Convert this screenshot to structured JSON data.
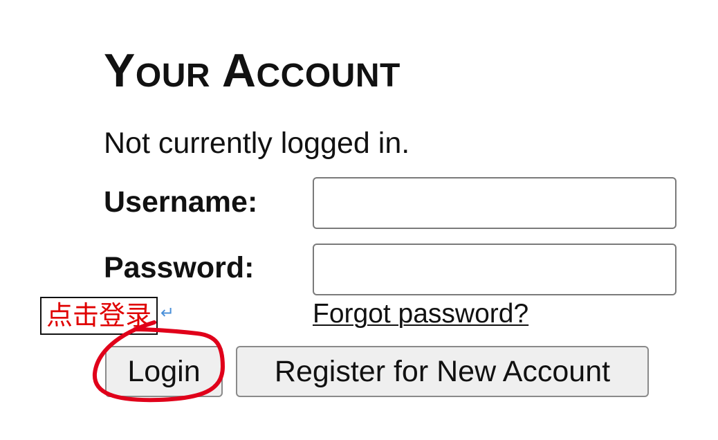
{
  "account": {
    "heading": "Your Account",
    "status_text": "Not currently logged in."
  },
  "form": {
    "username_label": "Username:",
    "username_value": "",
    "password_label": "Password:",
    "password_value": "",
    "forgot_link": "Forgot password?"
  },
  "buttons": {
    "login_label": "Login",
    "register_label": "Register for New Account"
  },
  "annotation": {
    "text": "点击登录",
    "return_symbol": "↵",
    "text_color": "#e00000",
    "circle_color": "#e0001a"
  }
}
